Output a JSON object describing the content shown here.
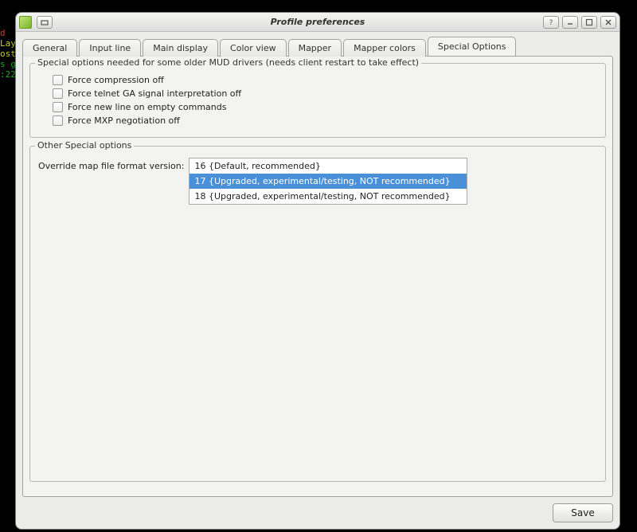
{
  "bg_terminal": {
    "l1": "d",
    "l2": "Lay",
    "l3": "ost",
    "l4": "s g",
    "l5": ":22"
  },
  "window": {
    "title": "Profile preferences"
  },
  "tabs": [
    {
      "label": "General"
    },
    {
      "label": "Input line"
    },
    {
      "label": "Main display"
    },
    {
      "label": "Color view"
    },
    {
      "label": "Mapper"
    },
    {
      "label": "Mapper colors"
    },
    {
      "label": "Special Options"
    }
  ],
  "active_tab_index": 6,
  "group1": {
    "legend": "Special options needed for some older MUD drivers (needs client restart to take effect)",
    "checkboxes": [
      "Force compression off",
      "Force telnet GA signal interpretation off",
      "Force new line on empty commands",
      "Force MXP negotiation off"
    ]
  },
  "group2": {
    "legend": "Other Special options",
    "override_label": "Override map file format version:",
    "options": [
      "16 {Default, recommended}",
      "17 {Upgraded, experimental/testing, NOT recommended}",
      "18 {Upgraded, experimental/testing, NOT recommended}"
    ],
    "selected_index": 1
  },
  "footer": {
    "save": "Save"
  }
}
